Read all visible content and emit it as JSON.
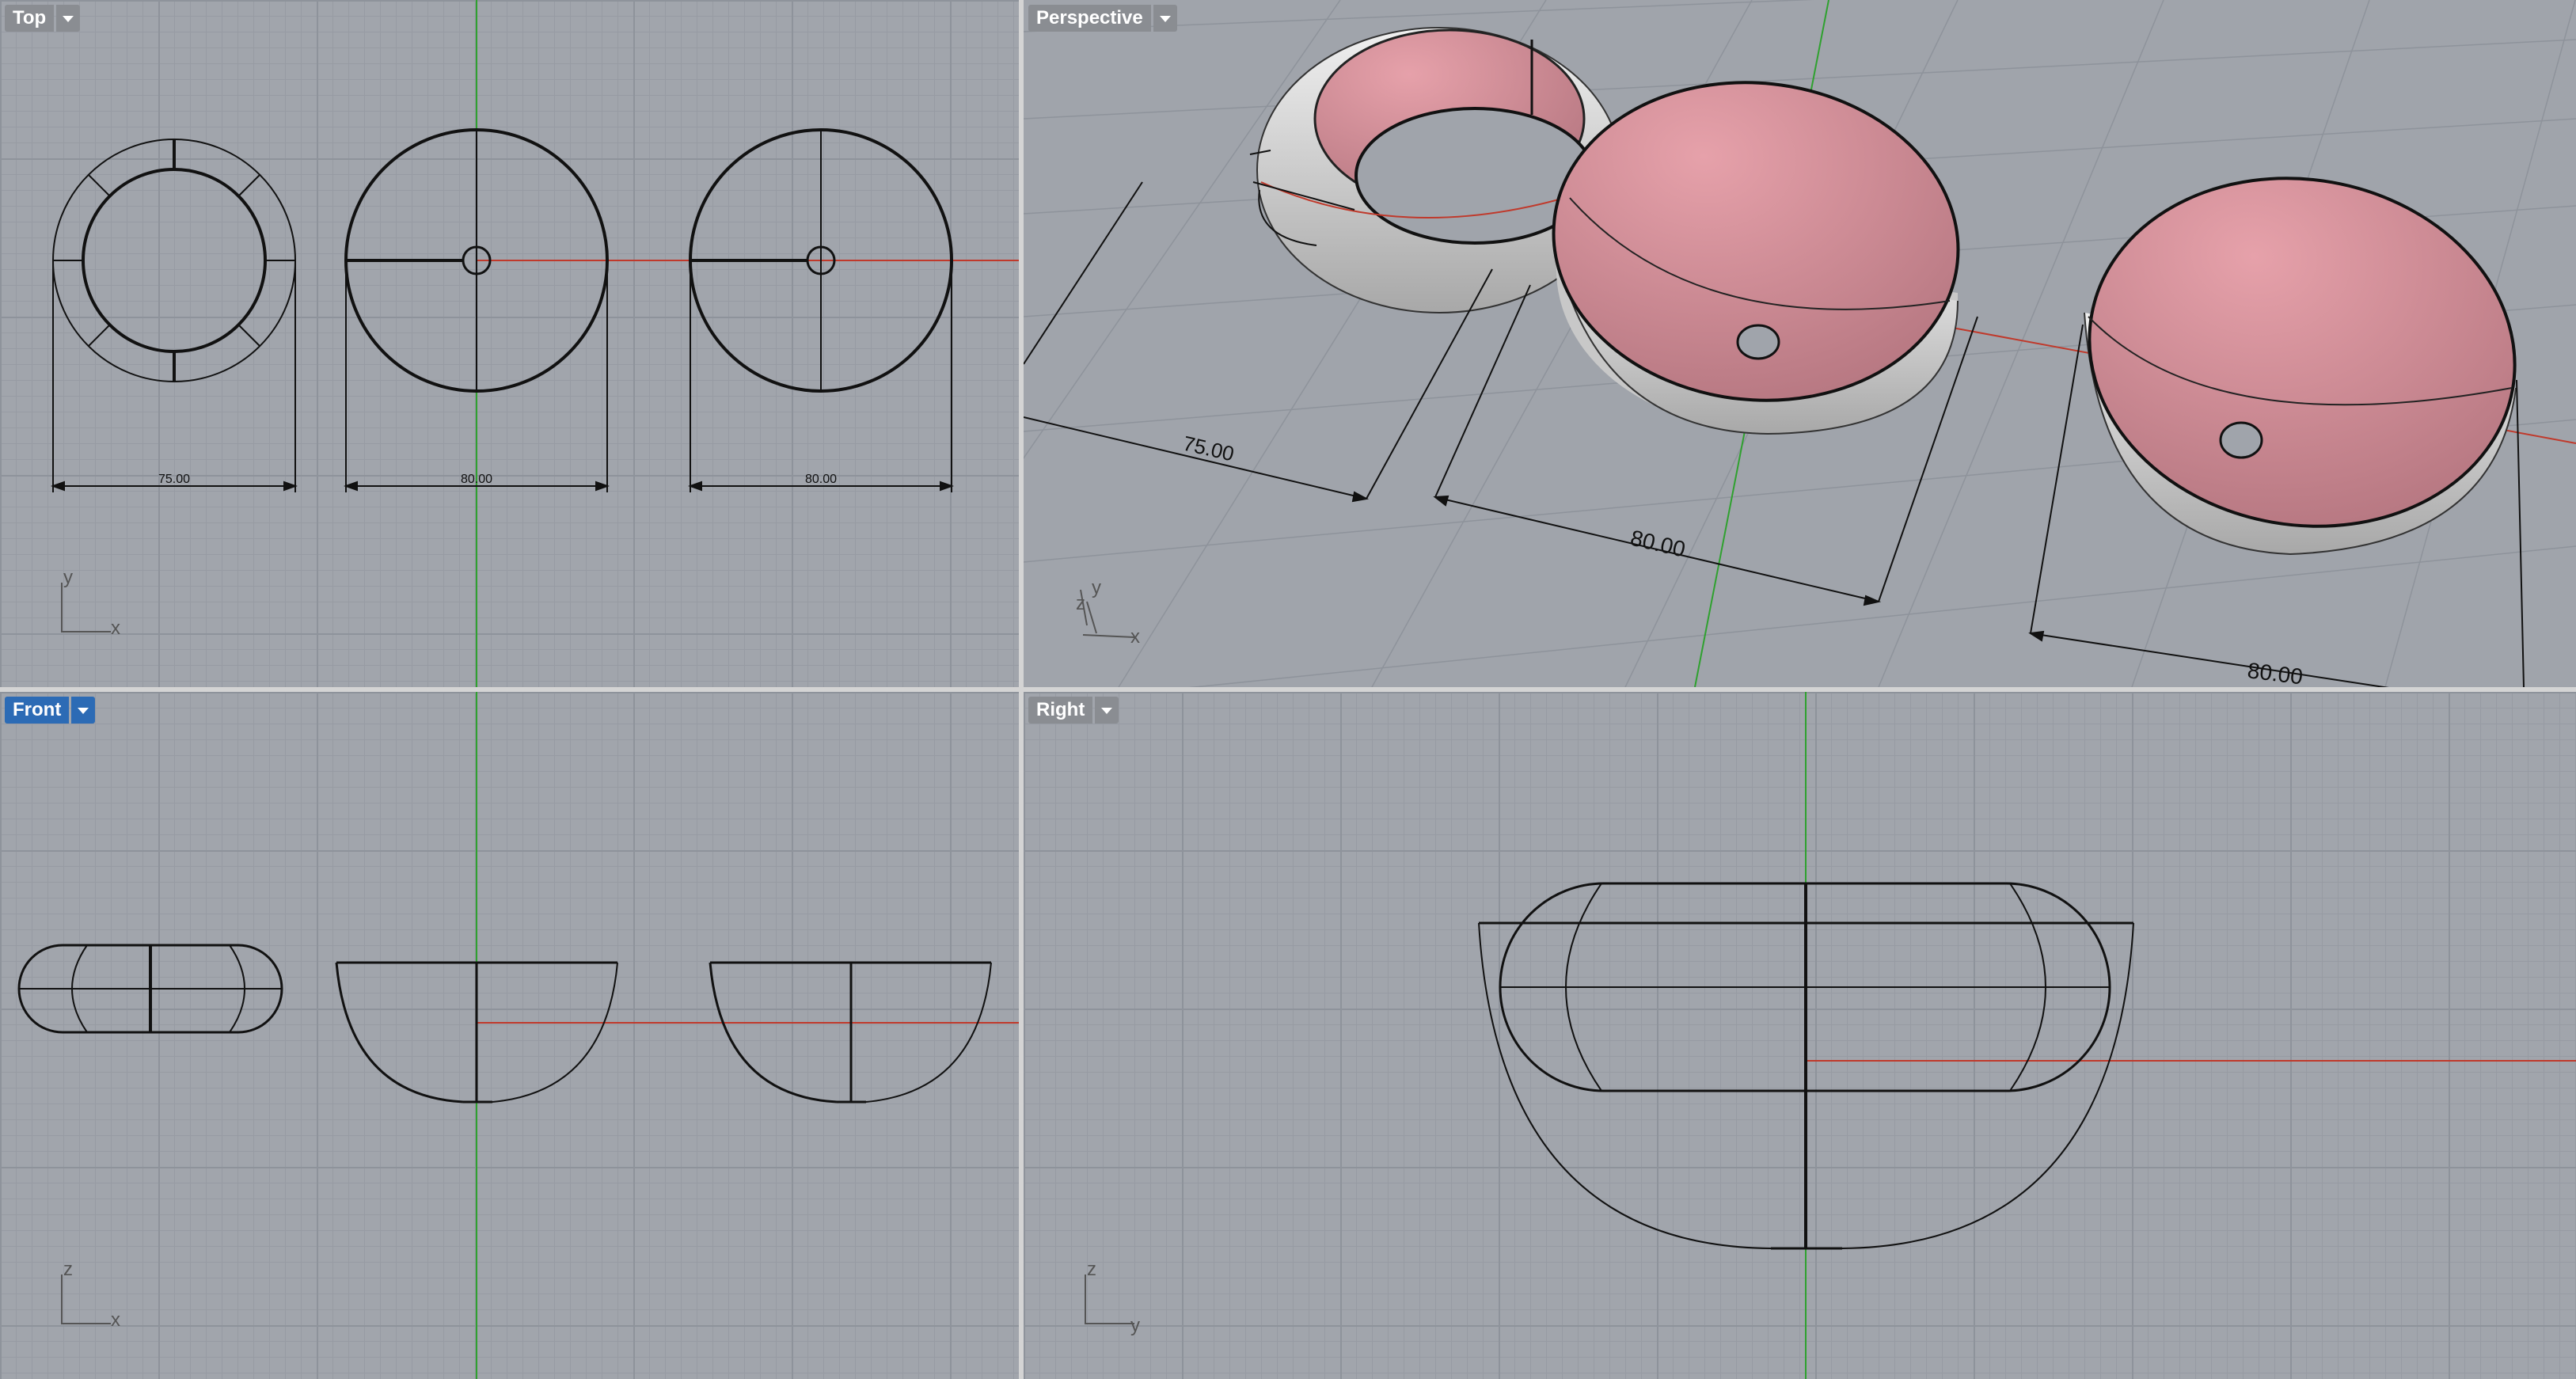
{
  "viewports": {
    "top": {
      "label": "Top",
      "active": false,
      "axes": [
        "y",
        "x"
      ]
    },
    "perspective": {
      "label": "Perspective",
      "active": false,
      "axes": [
        "z",
        "y",
        "x"
      ]
    },
    "front": {
      "label": "Front",
      "active": true,
      "axes": [
        "z",
        "x"
      ]
    },
    "right": {
      "label": "Right",
      "active": false,
      "axes": [
        "z",
        "y"
      ]
    }
  },
  "dimensions": {
    "ring_width": "75.00",
    "bowl1_width": "80.00",
    "bowl2_width": "80.00"
  },
  "colors": {
    "viewport_bg": "#a1a5ac",
    "active_tab": "#2c6bb5",
    "inactive_tab": "#8a8d92",
    "x_axis": "#c0392b",
    "y_axis": "#27a02a",
    "surface_inside": "#d98e98",
    "surface_outside": "#d8d8d8"
  }
}
